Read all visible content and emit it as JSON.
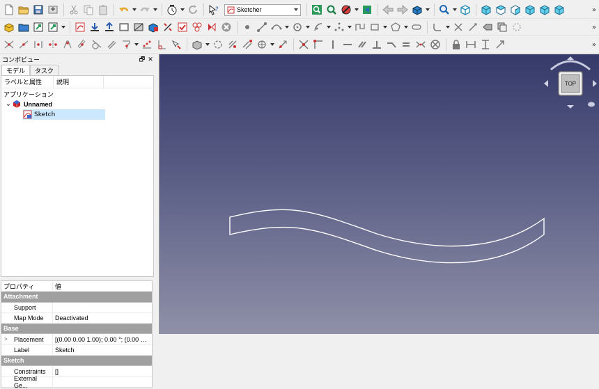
{
  "toolbar": {
    "workbench_selector": "Sketcher",
    "overflow_label": "»"
  },
  "combo_view": {
    "title": "コンボビュー",
    "float_button": "🗗",
    "close_button": "✕",
    "tabs": [
      {
        "label": "モデル",
        "active": true
      },
      {
        "label": "タスク",
        "active": false
      }
    ]
  },
  "tree": {
    "columns": [
      "ラベルと属性",
      "説明"
    ],
    "section_label": "アプリケーション",
    "document": {
      "label": "Unnamed",
      "expand_glyph": "⌄"
    },
    "children": [
      {
        "label": "Sketch",
        "selected": true
      }
    ]
  },
  "property_editor": {
    "columns": [
      "プロパティ",
      "値"
    ],
    "groups": [
      {
        "name": "Attachment",
        "rows": [
          {
            "key": "Support",
            "value": "",
            "expandable": false
          },
          {
            "key": "Map Mode",
            "value": "Deactivated",
            "expandable": false
          }
        ]
      },
      {
        "name": "Base",
        "rows": [
          {
            "key": "Placement",
            "value": "[(0.00 0.00 1.00); 0.00 °; (0.00 mm ...",
            "expandable": true
          },
          {
            "key": "Label",
            "value": "Sketch",
            "expandable": false
          }
        ]
      },
      {
        "name": "Sketch",
        "rows": [
          {
            "key": "Constraints",
            "value": "[]",
            "expandable": false
          },
          {
            "key": "External Ge...",
            "value": "",
            "expandable": false
          }
        ]
      }
    ]
  },
  "viewport": {
    "navcube_face": "TOP",
    "background_top": "#363a6a",
    "background_bottom": "#8f90a8",
    "sketch_stroke_color": "#ffffff"
  }
}
